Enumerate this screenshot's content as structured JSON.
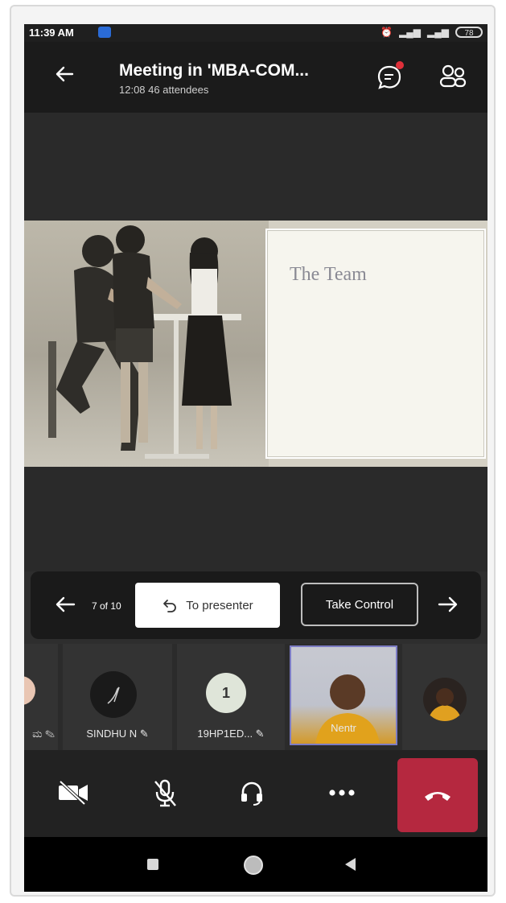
{
  "status_bar": {
    "time": "11:39 AM",
    "battery": "78"
  },
  "header": {
    "title": "Meeting in 'MBA-COM...",
    "duration": "12:08",
    "attendees": "46 attendees"
  },
  "slide": {
    "title": "The Team"
  },
  "presentation_controls": {
    "page_indicator": "7 of 10",
    "to_presenter_label": "To presenter",
    "take_control_label": "Take Control"
  },
  "participants": [
    {
      "label": "ಮ"
    },
    {
      "label": "SINDHU N"
    },
    {
      "label": "19HP1ED...",
      "avatar_text": "1"
    },
    {
      "label": "Nentr"
    },
    {
      "label": ""
    }
  ],
  "colors": {
    "hangup": "#b5283f",
    "chat_badge": "#e0303a",
    "header_bg": "#1b1b1b"
  }
}
